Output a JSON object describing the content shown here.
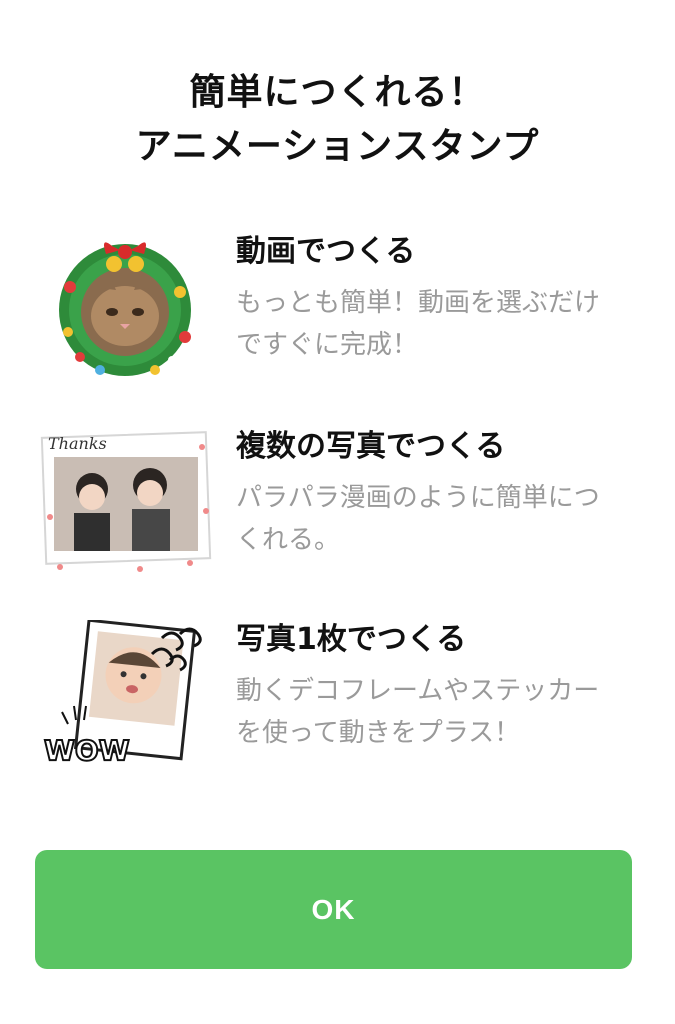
{
  "title": {
    "line1": "簡単につくれる！",
    "line2": "アニメーションスタンプ"
  },
  "features": [
    {
      "heading": "動画でつくる",
      "description": "もっとも簡単！動画を選ぶだけですぐに完成！",
      "thumb_icon": "christmas-wreath-cat-icon"
    },
    {
      "heading": "複数の写真でつくる",
      "description": "パラパラ漫画のように簡単につくれる。",
      "thumb_icon": "photo-collage-icon",
      "thumb_text": "Thanks"
    },
    {
      "heading": "写真1枚でつくる",
      "description": "動くデコフレームやステッカーを使って動きをプラス！",
      "thumb_icon": "polaroid-wow-icon",
      "thumb_text": "WOW"
    }
  ],
  "ok_button": {
    "label": "OK",
    "color": "#5ac463"
  }
}
